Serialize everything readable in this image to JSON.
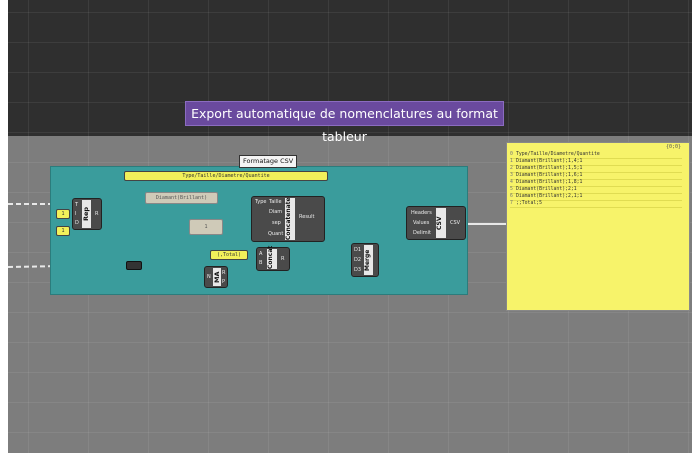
{
  "title": "Export automatique de nomenclatures au format tableur",
  "group_label": "Formatage CSV",
  "header_panel": "Type/Taille/Diametre/Quantite",
  "diamant_panel": "Diamant(Brillant)",
  "quant_panel": "1",
  "total_panel": "(,Total)",
  "small_values": [
    "1",
    "1"
  ],
  "rep": {
    "name": "Rep",
    "inputs": [
      "T",
      "I",
      "D"
    ],
    "outputs": [
      "R"
    ]
  },
  "concatenate": {
    "name": "Concatenate",
    "inputs": [
      "Type",
      "Taille",
      "Diam",
      "sep",
      "Quant"
    ],
    "output": "Result"
  },
  "concat": {
    "name": "Concat",
    "inputs": [
      "A",
      "B"
    ],
    "output": "R"
  },
  "ma": {
    "name": "MA",
    "inputs": [
      "N"
    ],
    "outputs": [
      "R",
      "P"
    ]
  },
  "merge": {
    "name": "Merge",
    "inputs": [
      "D1",
      "D2",
      "D3"
    ],
    "output": "R"
  },
  "csv": {
    "name": "CSV",
    "inputs": [
      "Headers",
      "Values",
      "Delimit"
    ],
    "output": "CSV"
  },
  "output_panel": {
    "header": "{0;0}",
    "rows": [
      {
        "idx": "0",
        "text": "Type/Taille/Diametre/Quantite"
      },
      {
        "idx": "1",
        "text": "Diamant(Brillant);1,4;1"
      },
      {
        "idx": "2",
        "text": "Diamant(Brillant);1,5;1"
      },
      {
        "idx": "3",
        "text": "Diamant(Brillant);1,6;1"
      },
      {
        "idx": "4",
        "text": "Diamant(Brillant);1,8;1"
      },
      {
        "idx": "5",
        "text": "Diamant(Brillant);2;1"
      },
      {
        "idx": "6",
        "text": "Diamant(Brillant);2,1;1"
      },
      {
        "idx": "7",
        "text": ";;Total;5"
      }
    ]
  }
}
